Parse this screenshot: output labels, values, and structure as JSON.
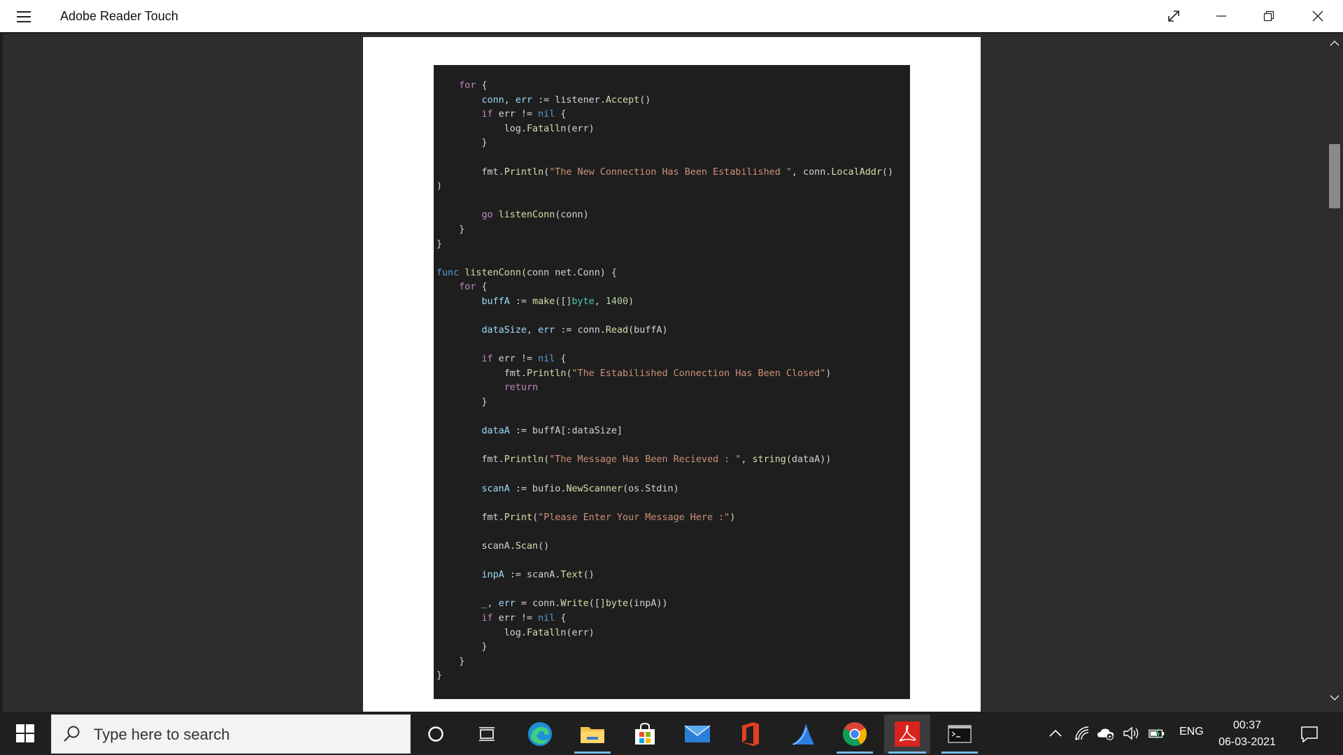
{
  "app": {
    "title": "Adobe Reader Touch"
  },
  "code_lines": [
    [
      [
        "    ",
        ""
      ],
      [
        "for",
        "kw"
      ],
      [
        " {",
        ""
      ]
    ],
    [
      [
        "        ",
        ""
      ],
      [
        "conn",
        "id"
      ],
      [
        ", ",
        ""
      ],
      [
        "err",
        "id"
      ],
      [
        " := listener.",
        ""
      ],
      [
        "Accept",
        "fn"
      ],
      [
        "()",
        ""
      ]
    ],
    [
      [
        "        ",
        ""
      ],
      [
        "if",
        "kw"
      ],
      [
        " err != ",
        ""
      ],
      [
        "nil",
        "lb"
      ],
      [
        " {",
        ""
      ]
    ],
    [
      [
        "            log.",
        ""
      ],
      [
        "Fatalln",
        "fn"
      ],
      [
        "(err)",
        ""
      ]
    ],
    [
      [
        "        }",
        ""
      ]
    ],
    [
      [
        "",
        ""
      ]
    ],
    [
      [
        "        fmt.",
        ""
      ],
      [
        "Println",
        "fn"
      ],
      [
        "(",
        ""
      ],
      [
        "\"The New Connection Has Been Estabilished \"",
        "st"
      ],
      [
        ", conn.",
        ""
      ],
      [
        "LocalAddr",
        "fn"
      ],
      [
        "()",
        ""
      ]
    ],
    [
      [
        ")",
        ""
      ]
    ],
    [
      [
        "",
        ""
      ]
    ],
    [
      [
        "        ",
        ""
      ],
      [
        "go",
        "kw"
      ],
      [
        " ",
        ""
      ],
      [
        "listenConn",
        "fn"
      ],
      [
        "(conn)",
        ""
      ]
    ],
    [
      [
        "    }",
        ""
      ]
    ],
    [
      [
        "}",
        ""
      ]
    ],
    [
      [
        "",
        ""
      ]
    ],
    [
      [
        "func",
        "lb"
      ],
      [
        " ",
        ""
      ],
      [
        "listenConn",
        "fn"
      ],
      [
        "(conn net.Conn) {",
        ""
      ]
    ],
    [
      [
        "    ",
        ""
      ],
      [
        "for",
        "kw"
      ],
      [
        " {",
        ""
      ]
    ],
    [
      [
        "        ",
        ""
      ],
      [
        "buffA",
        "id"
      ],
      [
        " := ",
        ""
      ],
      [
        "make",
        "fn"
      ],
      [
        "([]",
        ""
      ],
      [
        "byte",
        "ty"
      ],
      [
        ", ",
        ""
      ],
      [
        "1400",
        "nm"
      ],
      [
        ")",
        ""
      ]
    ],
    [
      [
        "",
        ""
      ]
    ],
    [
      [
        "        ",
        ""
      ],
      [
        "dataSize",
        "id"
      ],
      [
        ", ",
        ""
      ],
      [
        "err",
        "id"
      ],
      [
        " := conn.",
        ""
      ],
      [
        "Read",
        "fn"
      ],
      [
        "(buffA)",
        ""
      ]
    ],
    [
      [
        "",
        ""
      ]
    ],
    [
      [
        "        ",
        ""
      ],
      [
        "if",
        "kw"
      ],
      [
        " err != ",
        ""
      ],
      [
        "nil",
        "lb"
      ],
      [
        " {",
        ""
      ]
    ],
    [
      [
        "            fmt.",
        ""
      ],
      [
        "Println",
        "fn"
      ],
      [
        "(",
        ""
      ],
      [
        "\"The Estabilished Connection Has Been Closed\"",
        "st"
      ],
      [
        ")",
        ""
      ]
    ],
    [
      [
        "            ",
        ""
      ],
      [
        "return",
        "kw"
      ]
    ],
    [
      [
        "        }",
        ""
      ]
    ],
    [
      [
        "",
        ""
      ]
    ],
    [
      [
        "        ",
        ""
      ],
      [
        "dataA",
        "id"
      ],
      [
        " := buffA[:dataSize]",
        ""
      ]
    ],
    [
      [
        "",
        ""
      ]
    ],
    [
      [
        "        fmt.",
        ""
      ],
      [
        "Println",
        "fn"
      ],
      [
        "(",
        ""
      ],
      [
        "\"The Message Has Been Recieved : \"",
        "st"
      ],
      [
        ", ",
        ""
      ],
      [
        "string",
        "fn"
      ],
      [
        "(dataA))",
        ""
      ]
    ],
    [
      [
        "",
        ""
      ]
    ],
    [
      [
        "        ",
        ""
      ],
      [
        "scanA",
        "id"
      ],
      [
        " := bufio.",
        ""
      ],
      [
        "NewScanner",
        "fn"
      ],
      [
        "(os.Stdin)",
        ""
      ]
    ],
    [
      [
        "",
        ""
      ]
    ],
    [
      [
        "        fmt.",
        ""
      ],
      [
        "Print",
        "fn"
      ],
      [
        "(",
        ""
      ],
      [
        "\"Please Enter Your Message Here :\"",
        "st"
      ],
      [
        ")",
        ""
      ]
    ],
    [
      [
        "",
        ""
      ]
    ],
    [
      [
        "        scanA.",
        ""
      ],
      [
        "Scan",
        "fn"
      ],
      [
        "()",
        ""
      ]
    ],
    [
      [
        "",
        ""
      ]
    ],
    [
      [
        "        ",
        ""
      ],
      [
        "inpA",
        "id"
      ],
      [
        " := scanA.",
        ""
      ],
      [
        "Text",
        "fn"
      ],
      [
        "()",
        ""
      ]
    ],
    [
      [
        "",
        ""
      ]
    ],
    [
      [
        "        _, ",
        ""
      ],
      [
        "err",
        "id"
      ],
      [
        " = conn.",
        ""
      ],
      [
        "Write",
        "fn"
      ],
      [
        "([]",
        ""
      ],
      [
        "byte",
        "fn"
      ],
      [
        "(inpA))",
        ""
      ]
    ],
    [
      [
        "        ",
        ""
      ],
      [
        "if",
        "kw"
      ],
      [
        " err != ",
        ""
      ],
      [
        "nil",
        "lb"
      ],
      [
        " {",
        ""
      ]
    ],
    [
      [
        "            log.",
        ""
      ],
      [
        "Fatalln",
        "fn"
      ],
      [
        "(err)",
        ""
      ]
    ],
    [
      [
        "        }",
        ""
      ]
    ],
    [
      [
        "    }",
        ""
      ]
    ],
    [
      [
        "}",
        ""
      ]
    ]
  ],
  "taskbar": {
    "search_placeholder": "Type here to search",
    "apps": [
      "cortana",
      "task-view",
      "edge",
      "file-explorer",
      "microsoft-store",
      "mail",
      "office",
      "wireshark",
      "chrome",
      "adobe-reader",
      "command-prompt"
    ],
    "language": "ENG",
    "time": "00:37",
    "date": "06-03-2021"
  },
  "colors": {
    "accent": "#76b9ed",
    "code_bg": "#1e1e1e",
    "keyword": "#c586c0",
    "string": "#ce9178",
    "function": "#dcdcaa",
    "variable": "#9cdcfe"
  }
}
